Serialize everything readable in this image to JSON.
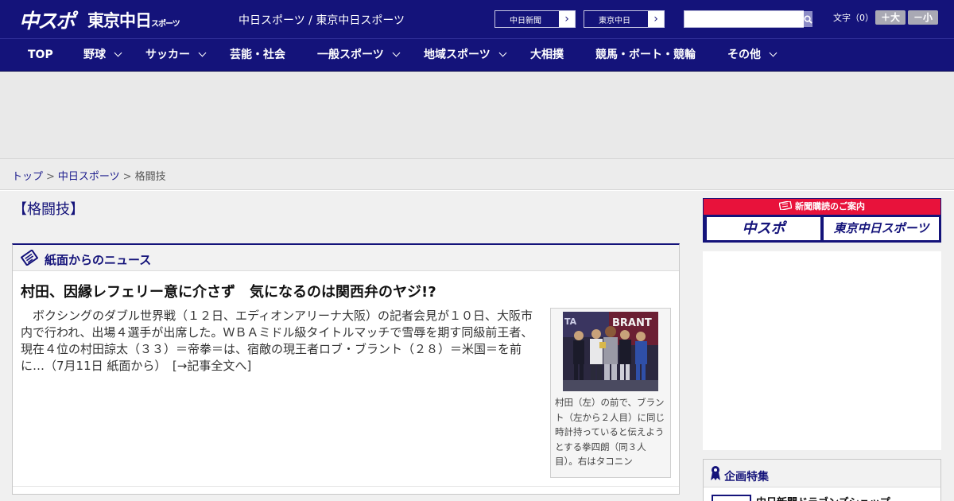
{
  "header": {
    "logo_chuspo": "中スポ",
    "logo_tokyo": "東京中日",
    "logo_tokyo_sub": "スポーツ",
    "site_title": "中日スポーツ / 東京中日スポーツ",
    "paper_links": [
      "中日新聞",
      "東京中日"
    ],
    "search_placeholder": "",
    "font_size_label": "文字（0）",
    "font_larger": "＋大",
    "font_smaller": "－小"
  },
  "nav": {
    "items": [
      {
        "label": "TOP",
        "dropdown": false
      },
      {
        "label": "野球",
        "dropdown": true
      },
      {
        "label": "サッカー",
        "dropdown": true
      },
      {
        "label": "芸能・社会",
        "dropdown": false
      },
      {
        "label": "一般スポーツ",
        "dropdown": true
      },
      {
        "label": "地域スポーツ",
        "dropdown": true
      },
      {
        "label": "大相撲",
        "dropdown": false
      },
      {
        "label": "競馬・ボート・競輪",
        "dropdown": false
      },
      {
        "label": "その他",
        "dropdown": true
      }
    ]
  },
  "breadcrumb": {
    "items": [
      "トップ",
      "中日スポーツ",
      "格闘技"
    ],
    "separator": ">"
  },
  "page": {
    "title": "【格闘技】"
  },
  "news": {
    "section_label": "紙面からのニュース",
    "headline": "村田、因縁レフェリー意に介さず　気になるのは関西弁のヤジ!?",
    "body": "ボクシングのダブル世界戦（１２日、エディオンアリーナ大阪）の記者会見が１０日、大阪市内で行われ、出場４選手が出席した。ＷＢＡミドル級タイトルマッチで雪辱を期す同級前王者、現在４位の村田諒太（３３）＝帝拳＝は、宿敵の現王者ロブ・ブラント（２８）＝米国＝を前に…（7月11日 紙面から）",
    "read_more": "[→記事全文へ]",
    "photo_caption": "村田（左）の前で、ブラント（左から２人目）に同じ時計持っていると伝えようとする拳四朗（同３人目）。右はタコニン"
  },
  "sidebar": {
    "subscribe_label": "新聞購読のご案内",
    "subscribe_logos": [
      "中スポ",
      "東京中日スポーツ"
    ],
    "feature_label": "企画特集",
    "feature_item": "中日新聞ドラゴンズショップ"
  },
  "colors": {
    "brand_navy": "#14137a",
    "subscribe_red": "#e8123b",
    "page_bg": "#f0f0f0"
  }
}
